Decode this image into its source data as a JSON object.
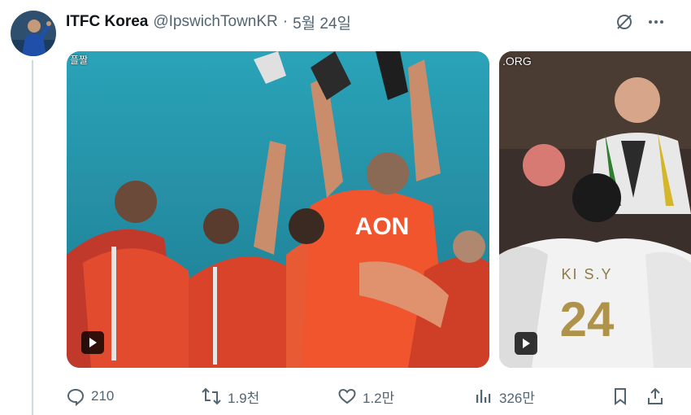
{
  "tweet": {
    "display_name": "ITFC Korea",
    "handle": "@IpswichTownKR",
    "separator": "·",
    "timestamp": "5월 24일"
  },
  "media": [
    {
      "overlay_label": "플짤",
      "type": "gif"
    },
    {
      "overlay_label": ".ORG",
      "type": "gif",
      "jersey_name": "KI S.Y",
      "jersey_number": "24"
    }
  ],
  "shirt_text": "AON",
  "actions": {
    "replies": "210",
    "retweets": "1.9천",
    "likes": "1.2만",
    "views": "326만"
  },
  "icons": [
    "grok-icon",
    "more-icon",
    "reply-icon",
    "retweet-icon",
    "like-icon",
    "views-icon",
    "bookmark-icon",
    "share-icon"
  ]
}
